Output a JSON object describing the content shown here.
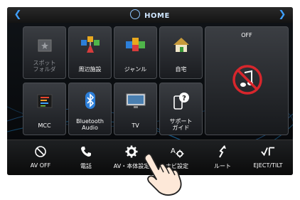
{
  "header": {
    "title": "HOME",
    "left_arrow_icon": "chevron-left",
    "right_arrow_icon": "chevron-right",
    "home_icon": "home-circle"
  },
  "tiles": [
    {
      "label": "スポット\nフォルダ",
      "icon": "spot-folder",
      "dimmed": true
    },
    {
      "label": "周辺施設",
      "icon": "nearby-facilities"
    },
    {
      "label": "ジャンル",
      "icon": "genre"
    },
    {
      "label": "自宅",
      "icon": "house"
    },
    {
      "label": "MCC",
      "icon": "mcc-equalizer"
    },
    {
      "label": "Bluetooth\nAudio",
      "icon": "bluetooth"
    },
    {
      "label": "TV",
      "icon": "tv"
    },
    {
      "label": "サポート\nガイド",
      "icon": "support-guide"
    }
  ],
  "audio_widget": {
    "status": "OFF",
    "icon": "no-audio-note"
  },
  "bottom_bar": [
    {
      "label": "AV OFF",
      "icon": "av-off"
    },
    {
      "label": "電話",
      "icon": "phone"
    },
    {
      "label": "AV・本体設定",
      "icon": "gear"
    },
    {
      "label": "ナビ設定",
      "icon": "navi-settings"
    },
    {
      "label": "ルート",
      "icon": "route"
    },
    {
      "label": "EJECT/TILT",
      "icon": "eject-tilt"
    }
  ],
  "colors": {
    "accent": "#3fa0ff",
    "background": "#0a0a0a",
    "tile_bg": "#2a2d32",
    "no_audio_red": "#d8262c"
  }
}
